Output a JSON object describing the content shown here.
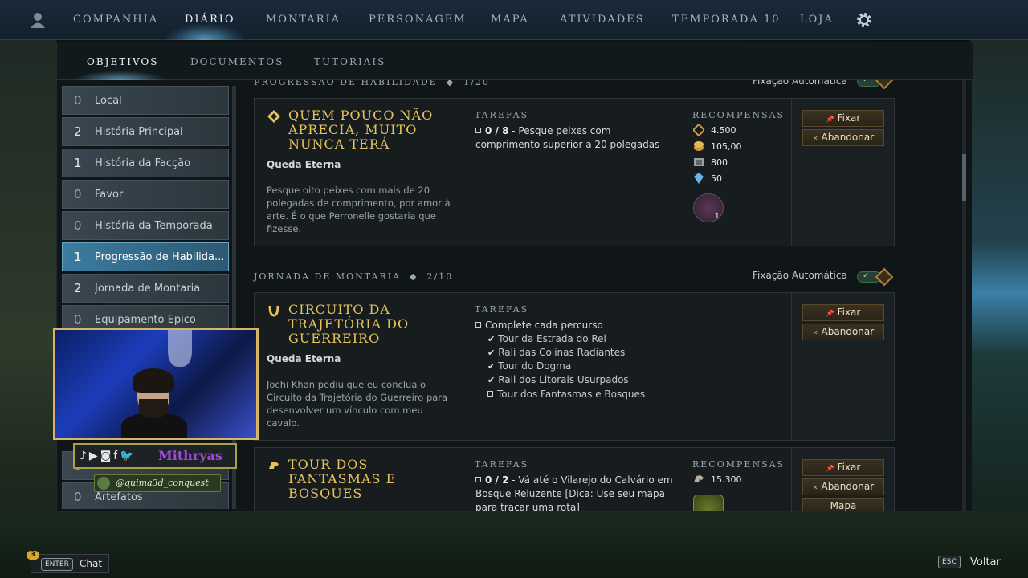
{
  "topnav": {
    "items": [
      "Companhia",
      "Diário",
      "Montaria",
      "Personagem",
      "Mapa",
      "Atividades",
      "Temporada 10",
      "Loja"
    ],
    "active": "Diário"
  },
  "subnav": {
    "tabs": [
      "OBJETIVOS",
      "DOCUMENTOS",
      "TUTORIAIS"
    ],
    "active": "OBJETIVOS"
  },
  "sidebar": {
    "items": [
      {
        "count": "0",
        "label": "Local"
      },
      {
        "count": "2",
        "label": "História Principal"
      },
      {
        "count": "1",
        "label": "História da Facção"
      },
      {
        "count": "0",
        "label": "Favor"
      },
      {
        "count": "0",
        "label": "História da Temporada"
      },
      {
        "count": "1",
        "label": "Progressão de Habilida..."
      },
      {
        "count": "2",
        "label": "Jornada de Montaria"
      },
      {
        "count": "0",
        "label": "Equipamento Épico"
      },
      {
        "count": "0",
        "label": ""
      },
      {
        "count": "0",
        "label": "Artefatos"
      }
    ],
    "active_index": 5
  },
  "sections": [
    {
      "header": "PROGRESSÃO DE HABILIDADE",
      "progress": "1/20",
      "auto_pin": "Fixação Automática"
    },
    {
      "header": "JORNADA DE MONTARIA",
      "progress": "2/10",
      "auto_pin": "Fixação Automática"
    }
  ],
  "quests": [
    {
      "title": "QUEM POUCO NÃO APRECIA, MUITO NUNCA TERÁ",
      "zone": "Queda Eterna",
      "description": "Pesque oito peixes com mais de 20 polegadas de comprimento, por amor à arte. É o que Perronelle gostaria que fizesse.",
      "tasks_header": "TAREFAS",
      "task_progress": "0 / 8",
      "task_text": " - Pesque peixes com comprimento superior a 20 polegadas",
      "rewards_header": "RECOMPENSAS",
      "rewards": [
        {
          "icon": "xp-icon",
          "value": "4.500"
        },
        {
          "icon": "coin-icon",
          "value": "105,00"
        },
        {
          "icon": "faction-token-icon",
          "value": "800"
        },
        {
          "icon": "crystal-icon",
          "value": "50"
        }
      ],
      "chest_count": "1",
      "actions": [
        "Fixar",
        "Abandonar"
      ]
    },
    {
      "title": "CIRCUITO DA TRAJETÓRIA DO GUERREIRO",
      "zone": "Queda Eterna",
      "description": "Jochi Khan pediu que eu conclua o Circuito da Trajetória do Guerreiro para desenvolver um vínculo com meu cavalo.",
      "tasks_header": "TAREFAS",
      "task_text": "Complete cada percurso",
      "subtasks": [
        {
          "done": true,
          "text": "Tour da Estrada do Rei"
        },
        {
          "done": true,
          "text": "Rali das Colinas Radiantes"
        },
        {
          "done": true,
          "text": "Tour do Dogma"
        },
        {
          "done": true,
          "text": "Rali dos Litorais Usurpados"
        },
        {
          "done": false,
          "text": "Tour dos Fantasmas e Bosques"
        }
      ],
      "actions": [
        "Fixar",
        "Abandonar"
      ]
    },
    {
      "title": "TOUR DOS FANTASMAS E BOSQUES",
      "tasks_header": "TAREFAS",
      "task_progress": "0 / 2",
      "task_text": " - Vá até o Vilarejo do Calvário em Bosque Reluzente [Dica: Use seu mapa para traçar uma rota]",
      "rewards_header": "RECOMPENSAS",
      "rewards": [
        {
          "icon": "horse-icon",
          "value": "15.300"
        }
      ],
      "actions": [
        "Fixar",
        "Abandonar",
        "Mapa"
      ]
    }
  ],
  "overlay": {
    "social_name": "Mithryas",
    "handle": "@quima3d_conquest"
  },
  "bottom": {
    "chat_badge": "3",
    "enter_key": "ENTER",
    "chat_label": "Chat",
    "esc_key": "ESC",
    "back_label": "Voltar"
  },
  "colors": {
    "quest_title": "#e7c35c",
    "active_tab": "#3b7ca0",
    "button_bg": "#3a3120"
  }
}
